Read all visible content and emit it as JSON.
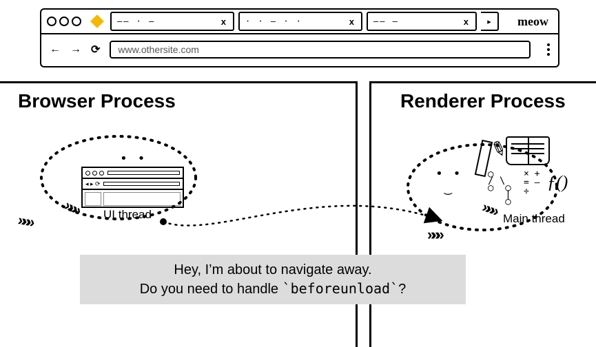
{
  "chrome": {
    "url": "www.othersite.com",
    "brand": "meow",
    "tabs": [
      {
        "label": "—— · —",
        "close": "x"
      },
      {
        "label": "· · — · ·",
        "close": "x"
      },
      {
        "label": "—— —",
        "close": "x"
      }
    ],
    "icons": {
      "back": "←",
      "forward": "→",
      "reload": "⟳",
      "extra_tab": "▸"
    }
  },
  "processes": {
    "browser": {
      "title": "Browser Process",
      "thread_label": "UI thread"
    },
    "renderer": {
      "title": "Renderer Process",
      "thread_label": "Main thread"
    }
  },
  "doodles": {
    "fx": "ƒ()",
    "ops_line1": "× +",
    "ops_line2": "= —",
    "ops_line3": "÷",
    "pencil": "✎",
    "tree": "○\n/ \\\n○  ○\n   |\n   ○"
  },
  "speech": {
    "line1": "Hey, I’m about to navigate away.",
    "line2_pre": "Do you need to handle ",
    "line2_code": "`beforeunload`",
    "line2_post": "?"
  },
  "glyphs": {
    "chevrons": "»»»",
    "smile": ". .\n ‿"
  }
}
